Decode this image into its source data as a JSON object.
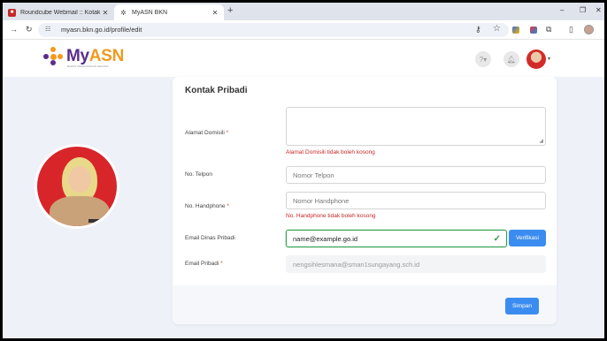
{
  "browser": {
    "tabs": [
      {
        "title": "Roundcube Webmail :: Kotak M",
        "active": false
      },
      {
        "title": "MyASN BKN",
        "active": true
      }
    ],
    "new_tab": "+",
    "window_controls": {
      "minimize": "–",
      "restore": "❐",
      "close": "✕"
    },
    "url": "myasn.bkn.go.id/profile/edit",
    "nav": {
      "back": "←",
      "forward": "→",
      "reload": "↻"
    }
  },
  "app": {
    "brand_my": "My",
    "brand_asn": "ASN",
    "tagline": "BADAN KEPEGAWAIAN NEGARA",
    "colors": {
      "purple": "#5a2d8c",
      "orange": "#f29a1f",
      "accent": "#3b8cf0",
      "error": "#c62828",
      "success": "#2e9d4d"
    }
  },
  "form": {
    "title": "Kontak Pribadi",
    "fields": {
      "alamat_domisili": {
        "label": "Alamat Domisili",
        "required": "*",
        "value": "",
        "error": "Alamat Domisili tidak boleh kosong"
      },
      "no_telpon": {
        "label": "No. Telpon",
        "placeholder": "Nomor Telpon"
      },
      "no_handphone": {
        "label": "No. Handphone",
        "required": "*",
        "placeholder": "Nomor Handphone",
        "error": "No. Handphone tidak boleh kosong"
      },
      "email_dinas": {
        "label": "Email Dinas Pribadi",
        "value": "name@example.go.id",
        "button": "Verifikasi"
      },
      "email_pribadi": {
        "label": "Email Pribadi",
        "required": "*",
        "value": "nengsihlesmana@sman1sungayang.sch.id"
      }
    },
    "save_button": "Simpan"
  }
}
